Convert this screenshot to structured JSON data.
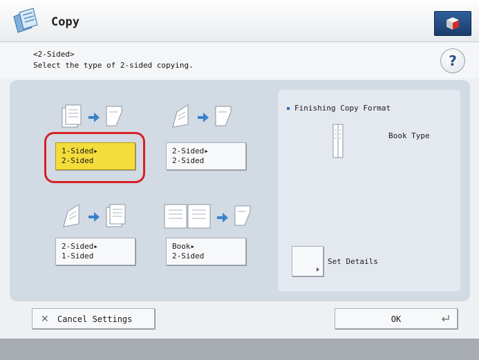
{
  "window": {
    "title": "Copy",
    "app_icon": "copy-icon",
    "status_icon": "counter-check-icon"
  },
  "screen": {
    "subtitle": "<2-Sided>",
    "instruction": "Select the type of 2-sided copying.",
    "help_label": "?"
  },
  "options": [
    {
      "line1": "1-Sided▸",
      "line2": "2-Sided",
      "selected": true,
      "icon": "1-sided-to-2-sided-icon"
    },
    {
      "line1": "2-Sided▸",
      "line2": "2-Sided",
      "selected": false,
      "icon": "2-sided-to-2-sided-icon"
    },
    {
      "line1": "2-Sided▸",
      "line2": "1-Sided",
      "selected": false,
      "icon": "2-sided-to-1-sided-icon"
    },
    {
      "line1": "Book▸",
      "line2": "2-Sided",
      "selected": false,
      "icon": "book-to-2-sided-icon"
    }
  ],
  "finishing": {
    "title": "Finishing Copy Format",
    "value": "Book Type",
    "icon": "book-type-icon",
    "set_details_label": "Set Details"
  },
  "footer": {
    "cancel_label": "Cancel Settings",
    "ok_label": "OK"
  },
  "colors": {
    "accent": "#1a3d6b",
    "selected": "#f4dc3b",
    "highlight_ring": "#d81f26",
    "panel": "#d2dae3"
  }
}
